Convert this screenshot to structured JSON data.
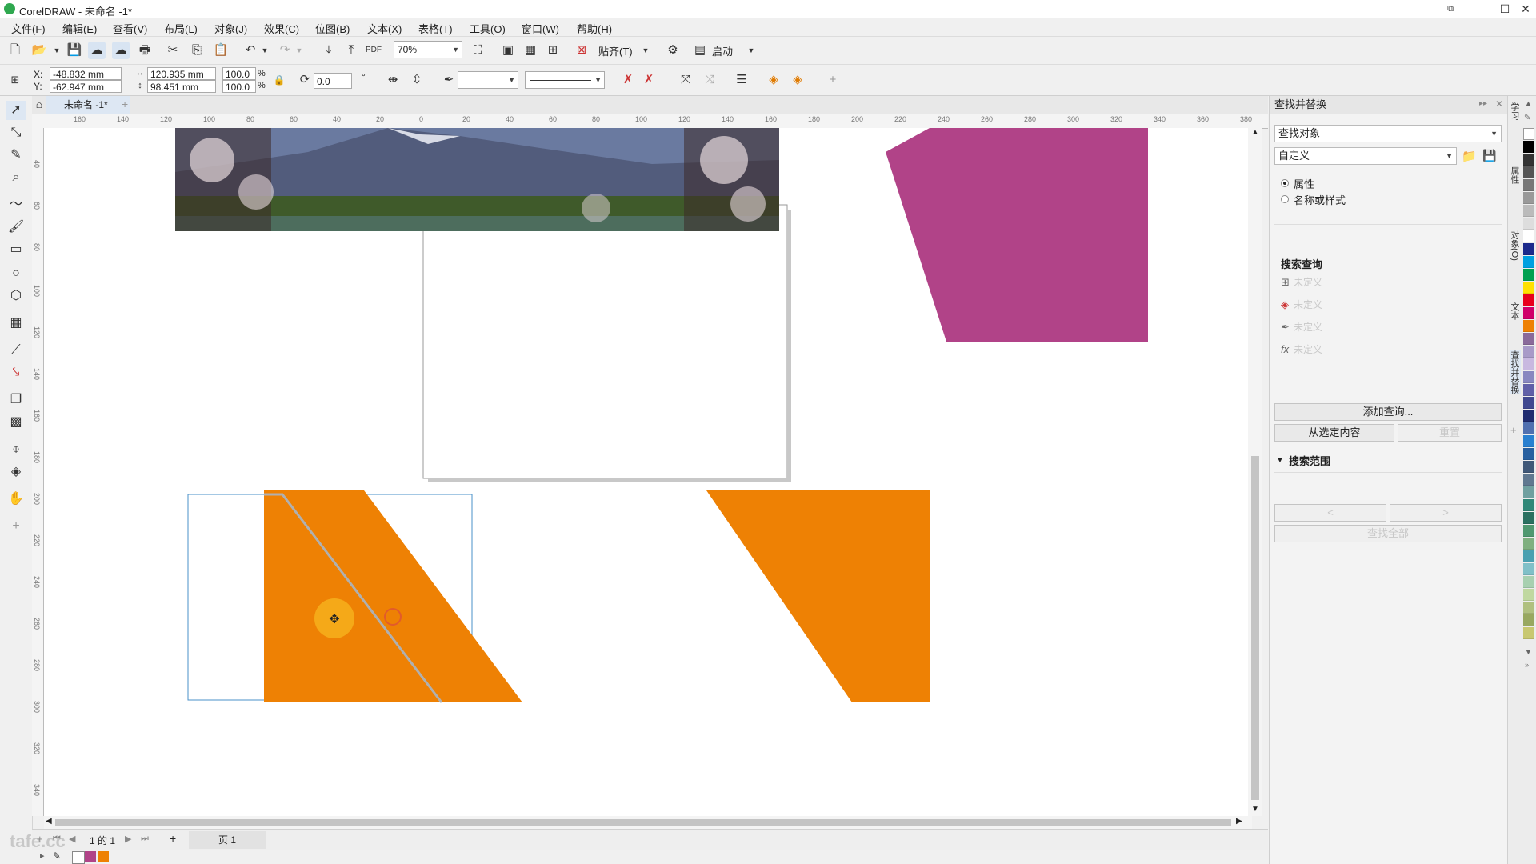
{
  "window": {
    "title": "CorelDRAW - 未命名 -1*",
    "controls": [
      "⧉",
      "—",
      "☐",
      "✕"
    ]
  },
  "menu": [
    "文件(F)",
    "编辑(E)",
    "查看(V)",
    "布局(L)",
    "对象(J)",
    "效果(C)",
    "位图(B)",
    "文本(X)",
    "表格(T)",
    "工具(O)",
    "窗口(W)",
    "帮助(H)"
  ],
  "toolbar": {
    "zoom": "70%",
    "snap_label": "贴齐(T)",
    "launch_label": "启动"
  },
  "property_bar": {
    "x_label": "X:",
    "y_label": "Y:",
    "x_value": "-48.832 mm",
    "y_value": "-62.947 mm",
    "width": "120.935 mm",
    "height": "98.451 mm",
    "scale_w": "100.0",
    "scale_h": "100.0",
    "percent": "%",
    "rotation": "0.0",
    "rotation_unit": "°"
  },
  "document_tab": "未命名 -1*",
  "ruler_labels": [
    "160",
    "140",
    "120",
    "100",
    "80",
    "60",
    "40",
    "20",
    "0",
    "20",
    "40",
    "60",
    "80",
    "100",
    "120",
    "140",
    "160",
    "180",
    "200",
    "220",
    "240",
    "260",
    "280",
    "300",
    "320",
    "340",
    "360",
    "380"
  ],
  "ruler_vertical_labels": [
    "40",
    "60",
    "80",
    "100",
    "120",
    "140",
    "160",
    "180",
    "200",
    "220",
    "240",
    "260",
    "280",
    "300",
    "320",
    "340"
  ],
  "page_nav": {
    "page_count": "1 的 1",
    "page_tab": "页 1"
  },
  "docker": {
    "title": "查找并替换",
    "mode": "查找对象",
    "preset": "自定义",
    "radio_attr": "属性",
    "radio_name": "名称或样式",
    "search_query_title": "搜索查询",
    "undefined_rows": [
      "未定义",
      "未定义",
      "未定义",
      "未定义"
    ],
    "add_query": "添加查询...",
    "from_selection": "从选定内容",
    "reset": "重置",
    "search_scope_title": "搜索范围",
    "prev": "<",
    "next": ">",
    "find_all": "查找全部"
  },
  "vertical_tabs": [
    "学习",
    "属性",
    "对象(O)",
    "文本",
    "查找并替换"
  ],
  "colors": {
    "orange": "#ee8104",
    "magenta": "#b14388",
    "selection_blue": "#4a90c8"
  },
  "watermark": "tafe.cc"
}
